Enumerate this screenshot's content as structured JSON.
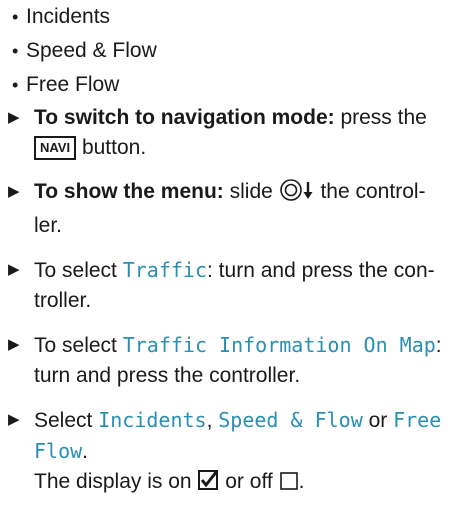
{
  "bullets": [
    "Incidents",
    "Speed & Flow",
    "Free Flow"
  ],
  "steps": {
    "s1": {
      "bold": "To switch to navigation mode:",
      "text_a": " press the",
      "key": "NAVI",
      "text_b": " button."
    },
    "s2": {
      "bold": "To show the menu:",
      "text_a": " slide ",
      "text_b": " the control-",
      "text_c": "ler."
    },
    "s3": {
      "text_a": "To select ",
      "mono": "Traffic",
      "text_b": ": turn and press the con-",
      "text_c": "troller."
    },
    "s4": {
      "text_a": "To select ",
      "mono": "Traffic Information On Map",
      "text_b": ":",
      "text_c": "turn and press the controller."
    },
    "s5": {
      "text_a": "Select ",
      "mono_a": "Incidents",
      "sep_a": ", ",
      "mono_b": "Speed & Flow",
      "sep_b": " or ",
      "mono_c": "Free",
      "mono_d": "Flow",
      "end": ".",
      "line2_a": "The display is on ",
      "line2_b": " or off ",
      "line2_c": "."
    }
  },
  "icons": {
    "step_marker": "triangle-right-icon",
    "controller": "controller-slide-down-icon",
    "checked": "checkbox-checked-icon",
    "unchecked": "checkbox-unchecked-icon"
  },
  "colors": {
    "accent": "#2a8fb4",
    "text": "#1a1a1a"
  }
}
